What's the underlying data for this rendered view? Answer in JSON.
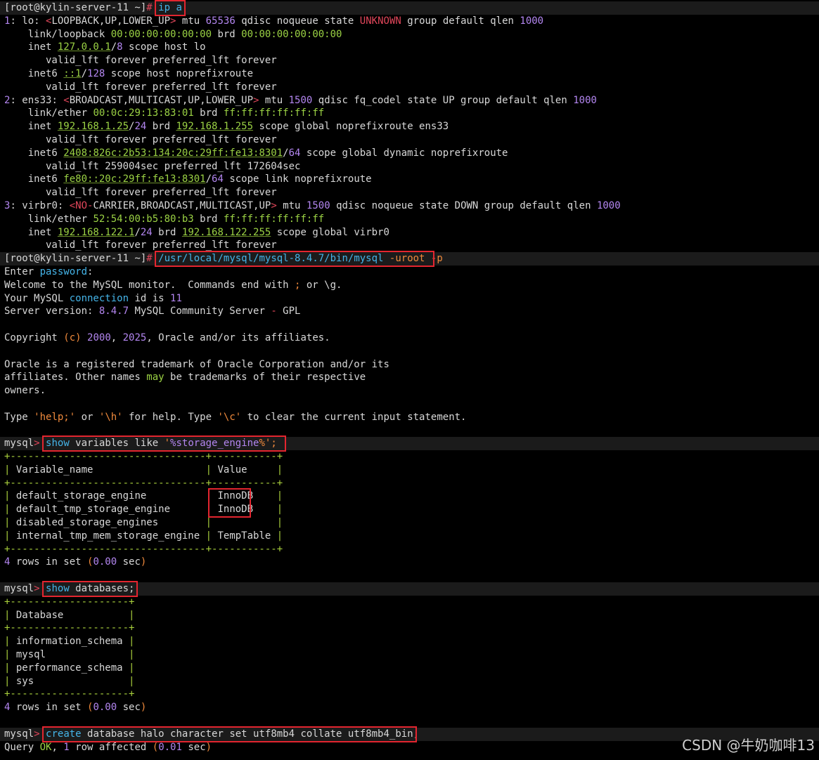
{
  "colors": {
    "background": "#000000",
    "text": "#d8d8d8",
    "number": "#b386f0",
    "keyword": "#45b4e8",
    "alert": "#e0465a",
    "option": "#f08a3c",
    "address": "#9bd244",
    "highlight_box": "#e3252f"
  },
  "terminal": {
    "lines": [
      {
        "id": "l1",
        "hl": true,
        "segs": [
          {
            "t": "[root@kylin-server-11 ~]"
          },
          {
            "t": "#",
            "c": "red"
          },
          {
            "t": " "
          },
          {
            "t": "ip a",
            "c": "kw"
          }
        ]
      },
      {
        "id": "l2",
        "segs": [
          {
            "t": "1",
            "c": "num"
          },
          {
            "t": ": lo: "
          },
          {
            "t": "<",
            "c": "red"
          },
          {
            "t": "LOOPBACK,UP,LOWER_UP"
          },
          {
            "t": ">",
            "c": "red"
          },
          {
            "t": " mtu "
          },
          {
            "t": "65536",
            "c": "num"
          },
          {
            "t": " qdisc noqueue state "
          },
          {
            "t": "UNKNOWN",
            "c": "red"
          },
          {
            "t": " group default qlen "
          },
          {
            "t": "1000",
            "c": "num"
          }
        ]
      },
      {
        "id": "l3",
        "segs": [
          {
            "t": "    link/loopback "
          },
          {
            "t": "00:00:00:00:00:00",
            "c": "green"
          },
          {
            "t": " brd "
          },
          {
            "t": "00:00:00:00:00:00",
            "c": "green"
          }
        ]
      },
      {
        "id": "l4",
        "segs": [
          {
            "t": "    inet "
          },
          {
            "t": "127.0.0.1",
            "c": "ip"
          },
          {
            "t": "/"
          },
          {
            "t": "8",
            "c": "num"
          },
          {
            "t": " scope host lo"
          }
        ]
      },
      {
        "id": "l5",
        "segs": [
          {
            "t": "       valid_lft forever preferred_lft forever"
          }
        ]
      },
      {
        "id": "l6",
        "segs": [
          {
            "t": "    inet6 "
          },
          {
            "t": "::1",
            "c": "ip"
          },
          {
            "t": "/"
          },
          {
            "t": "128",
            "c": "num"
          },
          {
            "t": " scope host noprefixroute"
          }
        ]
      },
      {
        "id": "l7",
        "segs": [
          {
            "t": "       valid_lft forever preferred_lft forever"
          }
        ]
      },
      {
        "id": "l8",
        "segs": [
          {
            "t": "2",
            "c": "num"
          },
          {
            "t": ": ens33: "
          },
          {
            "t": "<",
            "c": "red"
          },
          {
            "t": "BROADCAST,MULTICAST,UP,LOWER_UP"
          },
          {
            "t": ">",
            "c": "red"
          },
          {
            "t": " mtu "
          },
          {
            "t": "1500",
            "c": "num"
          },
          {
            "t": " qdisc fq_codel state UP group default qlen "
          },
          {
            "t": "1000",
            "c": "num"
          }
        ]
      },
      {
        "id": "l9",
        "segs": [
          {
            "t": "    link/ether "
          },
          {
            "t": "00:0c:29:13:83:01",
            "c": "green"
          },
          {
            "t": " brd "
          },
          {
            "t": "ff:ff:ff:ff:ff:ff",
            "c": "green"
          }
        ]
      },
      {
        "id": "l10",
        "segs": [
          {
            "t": "    inet "
          },
          {
            "t": "192.168.1.25",
            "c": "ip"
          },
          {
            "t": "/"
          },
          {
            "t": "24",
            "c": "num"
          },
          {
            "t": " brd "
          },
          {
            "t": "192.168.1.255",
            "c": "ip"
          },
          {
            "t": " scope global noprefixroute ens33"
          }
        ]
      },
      {
        "id": "l11",
        "segs": [
          {
            "t": "       valid_lft forever preferred_lft forever"
          }
        ]
      },
      {
        "id": "l12",
        "segs": [
          {
            "t": "    inet6 "
          },
          {
            "t": "2408:826c:2b53:134:20c:29ff:fe13:8301",
            "c": "ip"
          },
          {
            "t": "/"
          },
          {
            "t": "64",
            "c": "num"
          },
          {
            "t": " scope global dynamic noprefixroute"
          }
        ]
      },
      {
        "id": "l13",
        "segs": [
          {
            "t": "       valid_lft 259004sec preferred_lft 172604sec"
          }
        ]
      },
      {
        "id": "l14",
        "segs": [
          {
            "t": "    inet6 "
          },
          {
            "t": "fe80::20c:29ff:fe13:8301",
            "c": "ip"
          },
          {
            "t": "/"
          },
          {
            "t": "64",
            "c": "num"
          },
          {
            "t": " scope link noprefixroute"
          }
        ]
      },
      {
        "id": "l15",
        "segs": [
          {
            "t": "       valid_lft forever preferred_lft forever"
          }
        ]
      },
      {
        "id": "l16",
        "segs": [
          {
            "t": "3",
            "c": "num"
          },
          {
            "t": ": virbr0: "
          },
          {
            "t": "<NO-",
            "c": "red"
          },
          {
            "t": "CARRIER,BROADCAST,MULTICAST,UP"
          },
          {
            "t": ">",
            "c": "red"
          },
          {
            "t": " mtu "
          },
          {
            "t": "1500",
            "c": "num"
          },
          {
            "t": " qdisc noqueue state DOWN group default qlen "
          },
          {
            "t": "1000",
            "c": "num"
          }
        ]
      },
      {
        "id": "l17",
        "segs": [
          {
            "t": "    link/ether "
          },
          {
            "t": "52:54:00:b5:80:b3",
            "c": "green"
          },
          {
            "t": " brd "
          },
          {
            "t": "ff:ff:ff:ff:ff:ff",
            "c": "green"
          }
        ]
      },
      {
        "id": "l18",
        "segs": [
          {
            "t": "    inet "
          },
          {
            "t": "192.168.122.1",
            "c": "ip"
          },
          {
            "t": "/"
          },
          {
            "t": "24",
            "c": "num"
          },
          {
            "t": " brd "
          },
          {
            "t": "192.168.122.255",
            "c": "ip"
          },
          {
            "t": " scope global virbr0"
          }
        ]
      },
      {
        "id": "l19",
        "segs": [
          {
            "t": "       valid_lft forever preferred_lft forever"
          }
        ]
      },
      {
        "id": "l20",
        "hl": true,
        "segs": [
          {
            "t": "[root@kylin-server-11 ~]"
          },
          {
            "t": "#",
            "c": "red"
          },
          {
            "t": " "
          },
          {
            "t": "/usr/local/mysql/mysql-8.4.7/bin/mysql",
            "c": "kw"
          },
          {
            "t": " "
          },
          {
            "t": "-uroot",
            "c": "orange"
          },
          {
            "t": " "
          },
          {
            "t": "-p",
            "c": "orange"
          }
        ]
      },
      {
        "id": "l21",
        "segs": [
          {
            "t": "Enter "
          },
          {
            "t": "password",
            "c": "kw"
          },
          {
            "t": ":"
          }
        ]
      },
      {
        "id": "l22",
        "segs": [
          {
            "t": "Welcome to the MySQL monitor.  Commands end with "
          },
          {
            "t": ";",
            "c": "orange"
          },
          {
            "t": " or \\g."
          }
        ]
      },
      {
        "id": "l23",
        "segs": [
          {
            "t": "Your MySQL "
          },
          {
            "t": "connection",
            "c": "kw"
          },
          {
            "t": " id is "
          },
          {
            "t": "11",
            "c": "num"
          }
        ]
      },
      {
        "id": "l24",
        "segs": [
          {
            "t": "Server version: "
          },
          {
            "t": "8.4.7",
            "c": "num"
          },
          {
            "t": " MySQL Community Server "
          },
          {
            "t": "-",
            "c": "red"
          },
          {
            "t": " GPL"
          }
        ]
      },
      {
        "id": "l25",
        "segs": [
          {
            "t": ""
          }
        ]
      },
      {
        "id": "l26",
        "segs": [
          {
            "t": "Copyright "
          },
          {
            "t": "(c)",
            "c": "orange"
          },
          {
            "t": " "
          },
          {
            "t": "2000",
            "c": "num"
          },
          {
            "t": ", "
          },
          {
            "t": "2025",
            "c": "num"
          },
          {
            "t": ", Oracle and/or its affiliates."
          }
        ]
      },
      {
        "id": "l27",
        "segs": [
          {
            "t": ""
          }
        ]
      },
      {
        "id": "l28",
        "segs": [
          {
            "t": "Oracle is a registered trademark of Oracle Corporation and/or its"
          }
        ]
      },
      {
        "id": "l29",
        "segs": [
          {
            "t": "affiliates. Other names "
          },
          {
            "t": "may",
            "c": "green"
          },
          {
            "t": " be trademarks of their respective"
          }
        ]
      },
      {
        "id": "l30",
        "segs": [
          {
            "t": "owners."
          }
        ]
      },
      {
        "id": "l31",
        "segs": [
          {
            "t": ""
          }
        ]
      },
      {
        "id": "l32",
        "segs": [
          {
            "t": "Type "
          },
          {
            "t": "'help;'",
            "c": "orange"
          },
          {
            "t": " or "
          },
          {
            "t": "'\\h'",
            "c": "orange"
          },
          {
            "t": " for help. Type "
          },
          {
            "t": "'\\c'",
            "c": "orange"
          },
          {
            "t": " to clear the current input statement."
          }
        ]
      },
      {
        "id": "l33",
        "segs": [
          {
            "t": ""
          }
        ]
      },
      {
        "id": "l34",
        "hl": true,
        "segs": [
          {
            "t": "mysql"
          },
          {
            "t": ">",
            "c": "red"
          },
          {
            "t": " "
          },
          {
            "t": "show",
            "c": "kw"
          },
          {
            "t": " variables like "
          },
          {
            "t": "'",
            "c": "orange"
          },
          {
            "t": "%storage_engine",
            "c": "num"
          },
          {
            "t": "%';",
            "c": "orange"
          }
        ]
      },
      {
        "id": "l35",
        "segs": [
          {
            "t": "+---------------------------------+-----------+",
            "c": "table"
          }
        ]
      },
      {
        "id": "l36",
        "segs": [
          {
            "t": "|",
            "c": "table"
          },
          {
            "t": " Variable_name                   "
          },
          {
            "t": "|",
            "c": "table"
          },
          {
            "t": " Value     "
          },
          {
            "t": "|",
            "c": "table"
          }
        ]
      },
      {
        "id": "l37",
        "segs": [
          {
            "t": "+---------------------------------+-----------+",
            "c": "table"
          }
        ]
      },
      {
        "id": "l38",
        "segs": [
          {
            "t": "|",
            "c": "table"
          },
          {
            "t": " default_storage_engine          "
          },
          {
            "t": "|",
            "c": "table"
          },
          {
            "t": " InnoDB    "
          },
          {
            "t": "|",
            "c": "table"
          }
        ]
      },
      {
        "id": "l39",
        "segs": [
          {
            "t": "|",
            "c": "table"
          },
          {
            "t": " default_tmp_storage_engine      "
          },
          {
            "t": "|",
            "c": "table"
          },
          {
            "t": " InnoDB    "
          },
          {
            "t": "|",
            "c": "table"
          }
        ]
      },
      {
        "id": "l40",
        "segs": [
          {
            "t": "|",
            "c": "table"
          },
          {
            "t": " disabled_storage_engines        "
          },
          {
            "t": "|",
            "c": "table"
          },
          {
            "t": "           "
          },
          {
            "t": "|",
            "c": "table"
          }
        ]
      },
      {
        "id": "l41",
        "segs": [
          {
            "t": "|",
            "c": "table"
          },
          {
            "t": " internal_tmp_mem_storage_engine "
          },
          {
            "t": "|",
            "c": "table"
          },
          {
            "t": " TempTable "
          },
          {
            "t": "|",
            "c": "table"
          }
        ]
      },
      {
        "id": "l42",
        "segs": [
          {
            "t": "+---------------------------------+-----------+",
            "c": "table"
          }
        ]
      },
      {
        "id": "l43",
        "segs": [
          {
            "t": "4",
            "c": "num"
          },
          {
            "t": " rows in set "
          },
          {
            "t": "(",
            "c": "orange"
          },
          {
            "t": "0.00",
            "c": "num"
          },
          {
            "t": " sec"
          },
          {
            "t": ")",
            "c": "orange"
          }
        ]
      },
      {
        "id": "l44",
        "segs": [
          {
            "t": ""
          }
        ]
      },
      {
        "id": "l45",
        "hl": true,
        "segs": [
          {
            "t": "mysql"
          },
          {
            "t": ">",
            "c": "red"
          },
          {
            "t": " "
          },
          {
            "t": "show",
            "c": "kw"
          },
          {
            "t": " databases;"
          }
        ]
      },
      {
        "id": "l46",
        "segs": [
          {
            "t": "+--------------------+",
            "c": "table"
          }
        ]
      },
      {
        "id": "l47",
        "segs": [
          {
            "t": "|",
            "c": "table"
          },
          {
            "t": " Database           "
          },
          {
            "t": "|",
            "c": "table"
          }
        ]
      },
      {
        "id": "l48",
        "segs": [
          {
            "t": "+--------------------+",
            "c": "table"
          }
        ]
      },
      {
        "id": "l49",
        "segs": [
          {
            "t": "|",
            "c": "table"
          },
          {
            "t": " information_schema "
          },
          {
            "t": "|",
            "c": "table"
          }
        ]
      },
      {
        "id": "l50",
        "segs": [
          {
            "t": "|",
            "c": "table"
          },
          {
            "t": " mysql              "
          },
          {
            "t": "|",
            "c": "table"
          }
        ]
      },
      {
        "id": "l51",
        "segs": [
          {
            "t": "|",
            "c": "table"
          },
          {
            "t": " performance_schema "
          },
          {
            "t": "|",
            "c": "table"
          }
        ]
      },
      {
        "id": "l52",
        "segs": [
          {
            "t": "|",
            "c": "table"
          },
          {
            "t": " sys                "
          },
          {
            "t": "|",
            "c": "table"
          }
        ]
      },
      {
        "id": "l53",
        "segs": [
          {
            "t": "+--------------------+",
            "c": "table"
          }
        ]
      },
      {
        "id": "l54",
        "segs": [
          {
            "t": "4",
            "c": "num"
          },
          {
            "t": " rows in set "
          },
          {
            "t": "(",
            "c": "orange"
          },
          {
            "t": "0.00",
            "c": "num"
          },
          {
            "t": " sec"
          },
          {
            "t": ")",
            "c": "orange"
          }
        ]
      },
      {
        "id": "l55",
        "segs": [
          {
            "t": ""
          }
        ]
      },
      {
        "id": "l56",
        "hl": true,
        "segs": [
          {
            "t": "mysql"
          },
          {
            "t": ">",
            "c": "red"
          },
          {
            "t": " "
          },
          {
            "t": "create",
            "c": "kw"
          },
          {
            "t": " database halo character set utf8mb4 collate utf8mb4_bin;"
          }
        ]
      },
      {
        "id": "l57",
        "segs": [
          {
            "t": "Query "
          },
          {
            "t": "OK",
            "c": "green"
          },
          {
            "t": ", "
          },
          {
            "t": "1",
            "c": "num"
          },
          {
            "t": " row affected "
          },
          {
            "t": "(",
            "c": "orange"
          },
          {
            "t": "0.01",
            "c": "num"
          },
          {
            "t": " sec"
          },
          {
            "t": ")",
            "c": "orange"
          }
        ]
      }
    ]
  },
  "annotations": [
    {
      "name": "ip-a-command",
      "line": 0,
      "col_start": 26,
      "col_end": 30
    },
    {
      "name": "mysql-login-command",
      "line": 19,
      "col_start": 26,
      "col_end": 72
    },
    {
      "name": "show-variables-command",
      "line": 33,
      "col_start": 7,
      "col_end": 47
    },
    {
      "name": "innodb-values",
      "line": 37,
      "line_end": 38,
      "col_start": 35,
      "col_end": 41
    },
    {
      "name": "show-databases-command",
      "line": 44,
      "col_start": 7,
      "col_end": 22
    },
    {
      "name": "create-database-command",
      "line": 55,
      "col_start": 7,
      "col_end": 69
    }
  ],
  "watermark": "CSDN @牛奶咖啡13"
}
